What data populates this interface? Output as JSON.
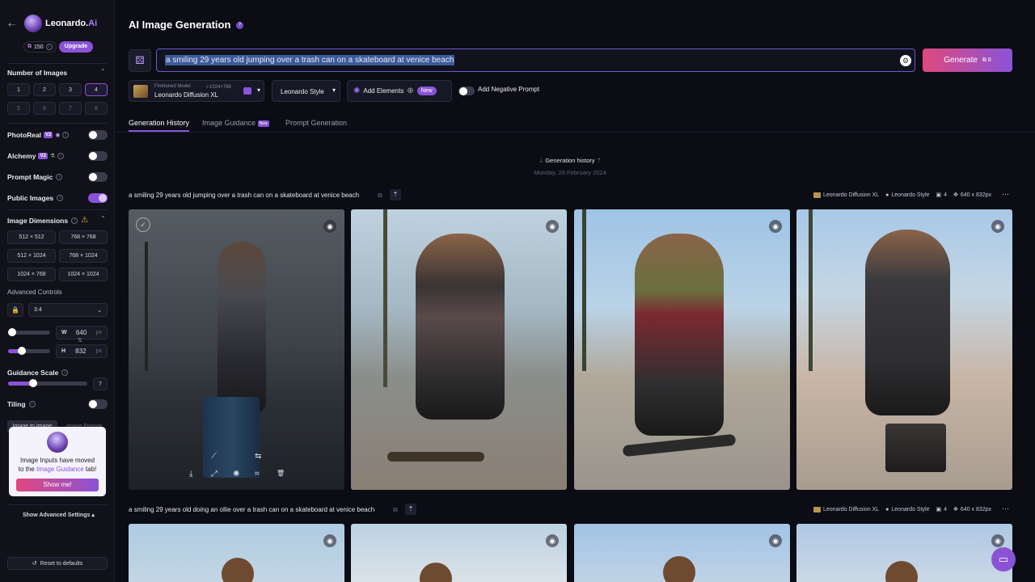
{
  "sidebar": {
    "brand": "Leonardo.",
    "brand_suffix": "Ai",
    "tokens": "150",
    "upgrade": "Upgrade",
    "num_images_label": "Number of Images",
    "num_options": [
      "1",
      "2",
      "3",
      "4",
      "5",
      "6",
      "7",
      "8"
    ],
    "photoreal": "PhotoReal",
    "alchemy": "Alchemy",
    "v2": "V2",
    "prompt_magic": "Prompt Magic",
    "public_images": "Public Images",
    "image_dimensions": "Image Dimensions",
    "dims": [
      "512 × 512",
      "768 × 768",
      "512 × 1024",
      "768 × 1024",
      "1024 × 768",
      "1024 × 1024"
    ],
    "advanced_controls": "Advanced Controls",
    "aspect": "3:4",
    "w_label": "W",
    "w_value": "640",
    "h_label": "H",
    "h_value": "832",
    "px": "px",
    "guidance_scale": "Guidance Scale",
    "guidance_value": "7",
    "tiling": "Tiling",
    "tab_img2img": "Image to Image",
    "tab_imgprompt": "Image Prompt",
    "popup_text_1": "Image Inputs have moved",
    "popup_text_2": "to the",
    "popup_link": "Image Guidance",
    "popup_text_3": "tab!",
    "show_me": "Show me!",
    "show_advanced": "Show Advanced Settings",
    "reset": "Reset to defaults"
  },
  "header": {
    "title": "AI Image Generation",
    "prompt": "a smiling 29 years old jumping over a trash can on a skateboard at venice beach",
    "generate": "Generate",
    "generate_cost": "8",
    "model_caption": "Finetuned Model",
    "model_size": "1024×768",
    "model_name": "Leonardo Diffusion XL",
    "style": "Leonardo Style",
    "add_elements": "Add Elements",
    "new": "New",
    "neg_prompt": "Add Negative Prompt"
  },
  "tabs": {
    "history": "Generation History",
    "guidance": "Image Guidance",
    "prompt_gen": "Prompt Generation"
  },
  "history": {
    "heading": "Generation history",
    "date": "Monday, 26 February 2024"
  },
  "generations": [
    {
      "prompt": "a smiling 29 years old jumping over a trash can on a skateboard at venice beach",
      "model": "Leonardo Diffusion XL",
      "style": "Leonardo Style",
      "count": "4",
      "size": "640 x 832px"
    },
    {
      "prompt": "a smiling 29 years old doing an ollie over a trash can on a skateboard at venice beach",
      "model": "Leonardo Diffusion XL",
      "style": "Leonardo Style",
      "count": "4",
      "size": "640 x 832px"
    }
  ],
  "colors": {
    "accent": "#8a53d6",
    "generate_gradient_start": "#e0487d",
    "generate_gradient_end": "#8a53d6",
    "background": "#0b0c14"
  }
}
